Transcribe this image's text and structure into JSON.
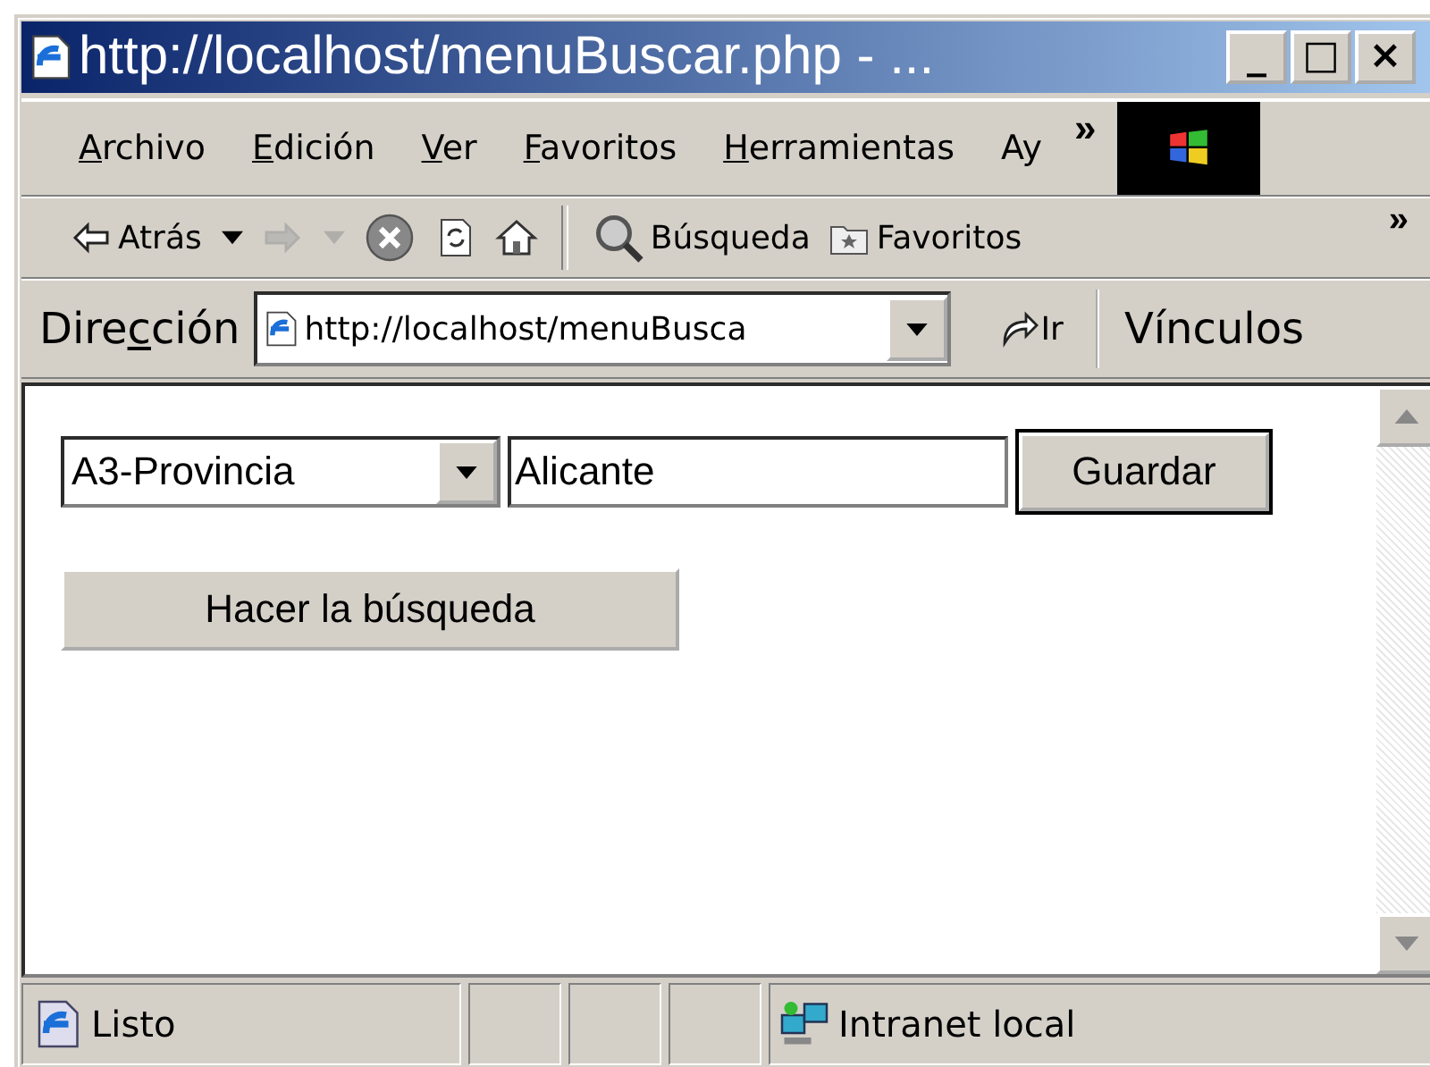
{
  "window": {
    "title": "http://localhost/menuBuscar.php - ...",
    "controls": [
      "_",
      "□",
      "×"
    ]
  },
  "menu": {
    "items": [
      {
        "key": "A",
        "rest": "rchivo"
      },
      {
        "key": "E",
        "rest": "dición"
      },
      {
        "key": "V",
        "rest": "er"
      },
      {
        "key": "F",
        "rest": "avoritos"
      },
      {
        "key": "H",
        "rest": "erramientas"
      },
      {
        "rest": "Ay"
      }
    ],
    "more": "»"
  },
  "toolbar": {
    "buttons": [
      {
        "kind": "back",
        "label": "Atrás",
        "dropdown": true,
        "disabled": false
      },
      {
        "kind": "forward",
        "dropdown": true,
        "disabled": true
      },
      {
        "kind": "stop",
        "dropdown": false,
        "disabled": false
      },
      {
        "kind": "refresh",
        "dropdown": false,
        "disabled": false
      },
      {
        "kind": "home",
        "dropdown": false,
        "disabled": false
      },
      {
        "kind": "separator"
      },
      {
        "kind": "search",
        "label": "Búsqueda",
        "dropdown": false,
        "disabled": false
      },
      {
        "kind": "favorites",
        "label": "Favoritos",
        "dropdown": false,
        "disabled": false
      }
    ],
    "more": "»"
  },
  "address_bar": {
    "label": {
      "pre": "Dire",
      "key": "c",
      "rest": "ción"
    },
    "value": "http://localhost/menuBusca",
    "go": "Ir",
    "links": "Vínculos"
  },
  "form": {
    "select": "A3-Provincia",
    "input": "Alicante",
    "save": "Guardar",
    "search": "Hacer la búsqueda"
  },
  "status_bar": {
    "text": "Listo",
    "zone": "Intranet local"
  }
}
